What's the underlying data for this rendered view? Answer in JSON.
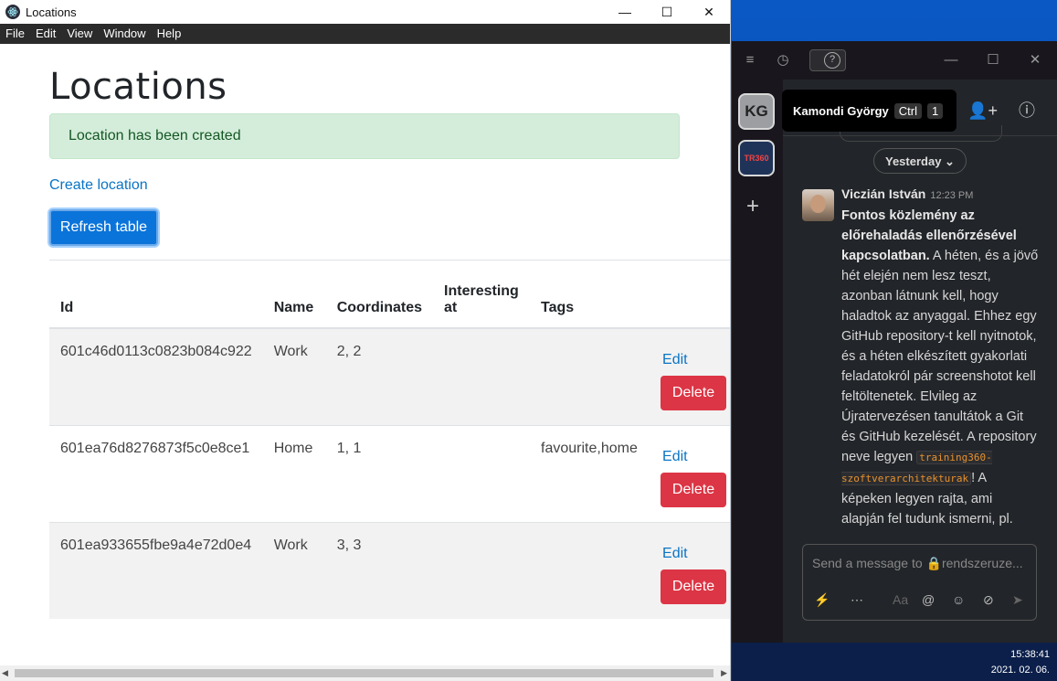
{
  "app": {
    "title": "Locations",
    "menu": [
      "File",
      "Edit",
      "View",
      "Window",
      "Help"
    ],
    "window_controls": {
      "minimize": "—",
      "maximize": "☐",
      "close": "✕"
    }
  },
  "page": {
    "title": "Locations",
    "alert": "Location has been created",
    "create_link": "Create location",
    "refresh_button": "Refresh table"
  },
  "table": {
    "headers": {
      "id": "Id",
      "name": "Name",
      "coordinates": "Coordinates",
      "interesting_at_1": "Interesting",
      "interesting_at_2": "at",
      "tags": "Tags"
    },
    "rows": [
      {
        "id": "601c46d0113c0823b084c922",
        "name": "Work",
        "coordinates": "2, 2",
        "interesting_at": "",
        "tags": "",
        "edit": "Edit",
        "delete": "Delete"
      },
      {
        "id": "601ea76d8276873f5c0e8ce1",
        "name": "Home",
        "coordinates": "1, 1",
        "interesting_at": "",
        "tags": "favourite,home",
        "edit": "Edit",
        "delete": "Delete"
      },
      {
        "id": "601ea933655fbe9a4e72d0e4",
        "name": "Work",
        "coordinates": "3, 3",
        "interesting_at": "",
        "tags": "",
        "edit": "Edit",
        "delete": "Delete"
      }
    ]
  },
  "chat": {
    "workspace_initials": "KG",
    "workspace2_label": "TR360",
    "tooltip": {
      "name": "Kamondi György",
      "key1": "Ctrl",
      "key2": "1"
    },
    "date_pill": "Yesterday ⌄",
    "sender": "Viczián István",
    "time": "12:23 PM",
    "message_bold": "Fontos közlemény az előrehaladás ellenőrzésével kapcsolatban.",
    "message_text": " A héten, és a jövő hét elején nem lesz teszt, azonban látnunk kell, hogy haladtok az anyaggal. Ehhez egy GitHub repository-t kell nyitnotok, és a héten elkészített gyakorlati feladatokról pár screenshotot kell feltöltenetek. Elvileg az Újratervezésen tanultátok a Git és GitHub kezelését. A repository neve legyen ",
    "message_code": "training360-szoftverarchitekturak",
    "message_tail": "! A képeken legyen rajta, ami alapján fel tudunk ismerni, pl.",
    "composer_placeholder": "Send a message to 🔒rendszeruze..."
  },
  "taskbar": {
    "time": "15:38:41",
    "date": "2021. 02. 06."
  }
}
